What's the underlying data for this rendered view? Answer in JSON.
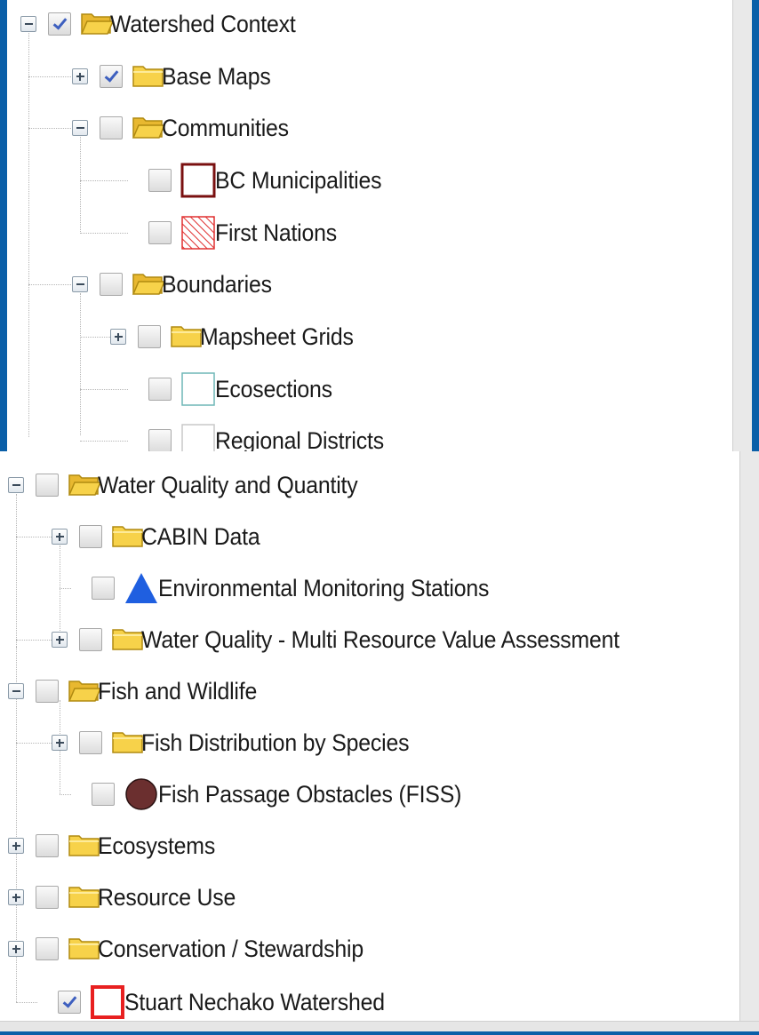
{
  "tree_top": {
    "items": [
      {
        "label": "Watershed Context",
        "checked": true,
        "expanded": true,
        "icon": "folder-open-icon"
      },
      {
        "label": "Base Maps",
        "checked": true,
        "expanded": false,
        "icon": "folder-icon"
      },
      {
        "label": "Communities",
        "checked": false,
        "expanded": true,
        "icon": "folder-open-icon"
      },
      {
        "label": "BC Municipalities",
        "checked": false,
        "icon": "polygon-outline-darkred-icon"
      },
      {
        "label": "First Nations",
        "checked": false,
        "icon": "hatched-red-polygon-icon"
      },
      {
        "label": "Boundaries",
        "checked": false,
        "expanded": true,
        "icon": "folder-open-icon"
      },
      {
        "label": "Mapsheet Grids",
        "checked": false,
        "expanded": false,
        "icon": "folder-icon"
      },
      {
        "label": "Ecosections",
        "checked": false,
        "icon": "polygon-outline-teal-icon"
      },
      {
        "label": "Regional Districts",
        "checked": false,
        "icon": "polygon-outline-gray-icon"
      }
    ]
  },
  "tree_bottom": {
    "items": [
      {
        "label": "Water Quality and Quantity",
        "checked": false,
        "expanded": true,
        "icon": "folder-open-icon"
      },
      {
        "label": "CABIN Data",
        "checked": false,
        "expanded": false,
        "icon": "folder-icon"
      },
      {
        "label": "Environmental Monitoring Stations",
        "checked": false,
        "icon": "blue-triangle-icon"
      },
      {
        "label": "Water Quality - Multi Resource Value Assessment",
        "checked": false,
        "expanded": false,
        "icon": "folder-icon"
      },
      {
        "label": "Fish and Wildlife",
        "checked": false,
        "expanded": true,
        "icon": "folder-open-icon"
      },
      {
        "label": "Fish Distribution by Species",
        "checked": false,
        "expanded": false,
        "icon": "folder-icon"
      },
      {
        "label": "Fish Passage Obstacles (FISS)",
        "checked": false,
        "icon": "brown-circle-icon"
      },
      {
        "label": "Ecosystems",
        "checked": false,
        "expanded": false,
        "icon": "folder-icon"
      },
      {
        "label": "Resource Use",
        "checked": false,
        "expanded": false,
        "icon": "folder-icon"
      },
      {
        "label": "Conservation / Stewardship",
        "checked": false,
        "expanded": false,
        "icon": "folder-icon"
      },
      {
        "label": "Stuart Nechako Watershed",
        "checked": true,
        "icon": "polygon-outline-red-icon"
      }
    ]
  },
  "colors": {
    "frame_background": "#0a5fa8",
    "folder_fill": "#f7d24a",
    "checkmark": "#3d5fbf",
    "municipalities_outline": "#7a1010",
    "first_nations_hatch": "#e03030",
    "ecosections_outline": "#6fb7b7",
    "stations_triangle": "#1f5fe0",
    "obstacles_circle": "#6b2f2f",
    "watershed_outline": "#e82020"
  }
}
